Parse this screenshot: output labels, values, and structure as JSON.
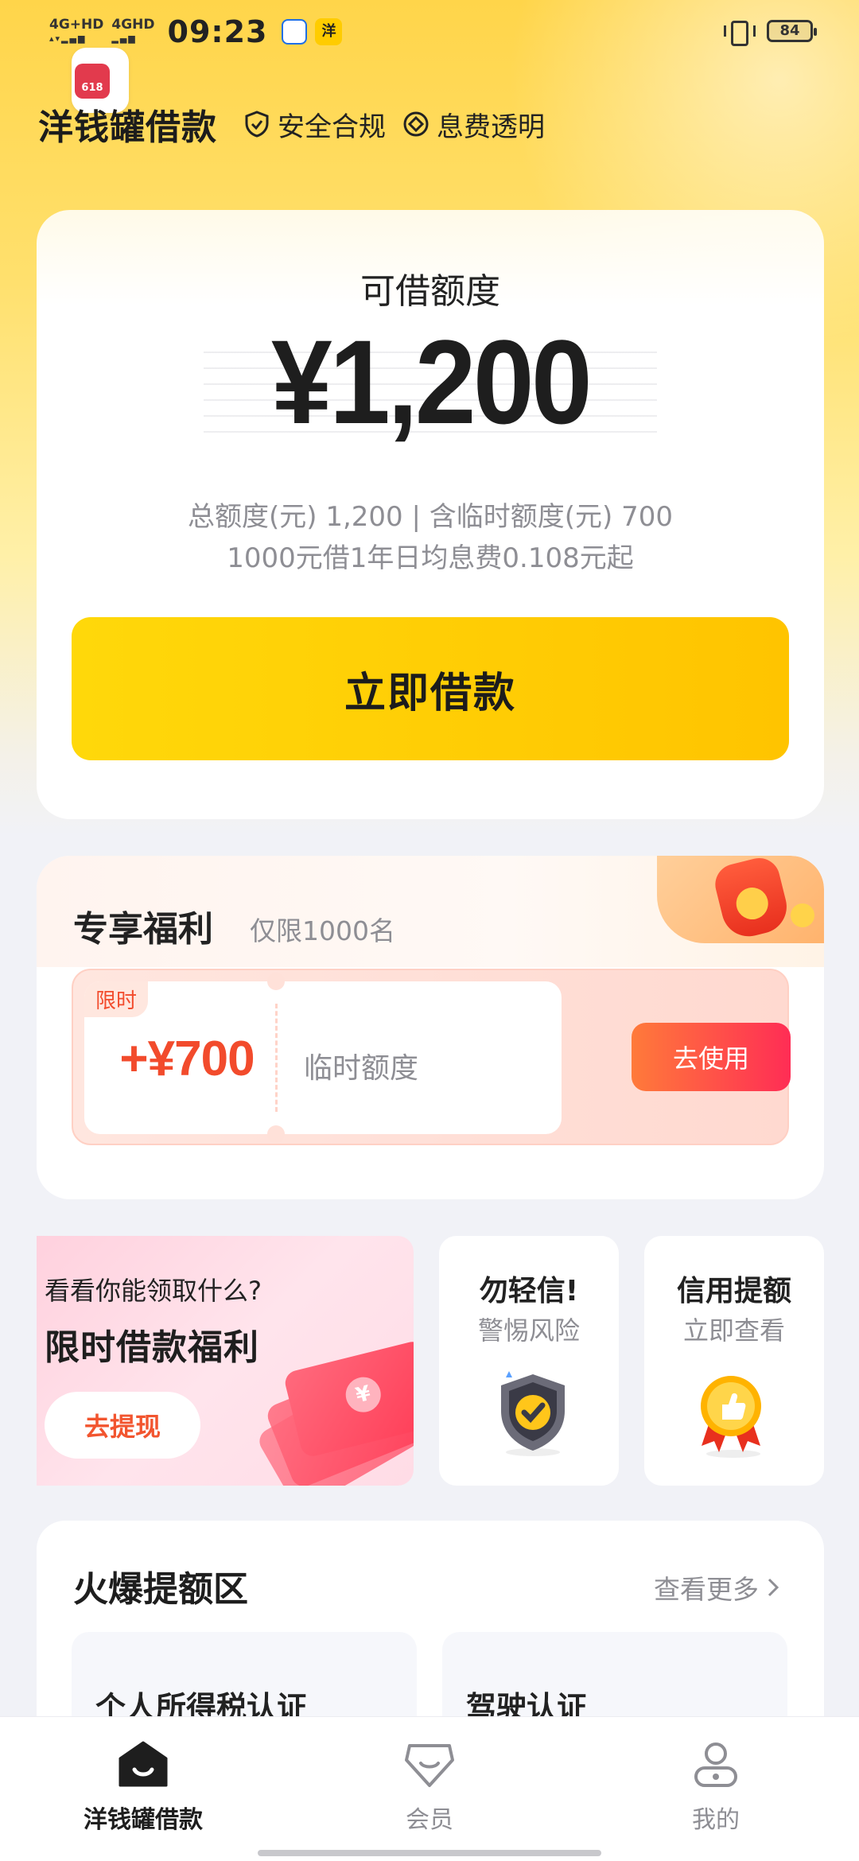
{
  "status_bar": {
    "network1": "4G+HD",
    "network2": "4GHD",
    "time": "09:23",
    "app_icon_text": "洋",
    "battery": "84"
  },
  "promo_badge": "618",
  "header": {
    "title": "洋钱罐借款",
    "tag1": "安全合规",
    "tag2": "息费透明"
  },
  "credit": {
    "label": "可借额度",
    "amount": "¥1,200",
    "total_line": "总额度(元)  1,200  |  含临时额度(元)  700",
    "rate_line": "1000元借1年日均息费0.108元起",
    "button": "立即借款"
  },
  "welfare": {
    "title": "专享福利",
    "subtitle": "仅限1000名",
    "coupon": {
      "tag": "限时",
      "amount": "+¥700",
      "name": "临时额度",
      "button": "去使用"
    }
  },
  "promos": {
    "big": {
      "question": "看看你能领取什么?",
      "headline": "限时借款福利",
      "button": "去提现"
    },
    "small1": {
      "title": "勿轻信!",
      "subtitle": "警惕风险"
    },
    "small2": {
      "title": "信用提额",
      "subtitle": "立即查看"
    }
  },
  "hot": {
    "title": "火爆提额区",
    "more": "查看更多",
    "items": [
      "个人所得税认证",
      "驾驶认证"
    ]
  },
  "nav": {
    "items": [
      {
        "label": "洋钱罐借款",
        "icon": "home-icon"
      },
      {
        "label": "会员",
        "icon": "vip-icon"
      },
      {
        "label": "我的",
        "icon": "profile-icon"
      }
    ]
  },
  "colors": {
    "brand_yellow": "#ffcc00",
    "accent_red": "#f24b2c"
  }
}
